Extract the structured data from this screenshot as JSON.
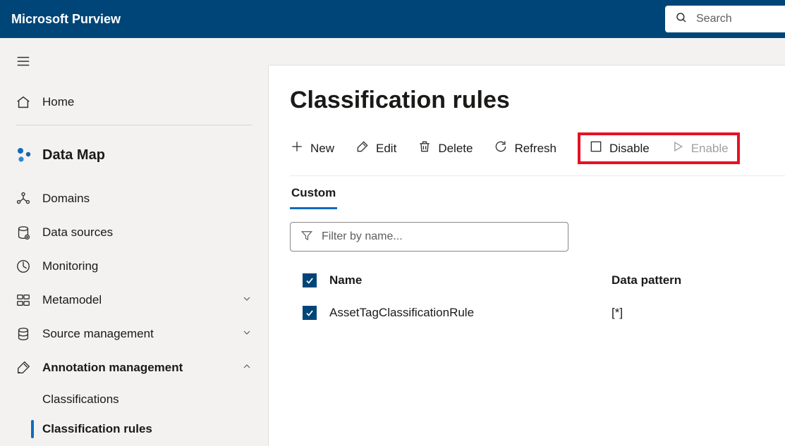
{
  "header": {
    "title": "Microsoft Purview",
    "search_placeholder": "Search"
  },
  "sidebar": {
    "home_label": "Home",
    "section_label": "Data Map",
    "items": {
      "domains": "Domains",
      "data_sources": "Data sources",
      "monitoring": "Monitoring",
      "metamodel": "Metamodel",
      "source_management": "Source management",
      "annotation_management": "Annotation management"
    },
    "sub_items": {
      "classifications": "Classifications",
      "classification_rules": "Classification rules"
    }
  },
  "main": {
    "page_title": "Classification rules",
    "toolbar": {
      "new": "New",
      "edit": "Edit",
      "delete": "Delete",
      "refresh": "Refresh",
      "disable": "Disable",
      "enable": "Enable"
    },
    "tabs": {
      "custom": "Custom"
    },
    "filter_placeholder": "Filter by name...",
    "table": {
      "col_name": "Name",
      "col_pattern": "Data pattern",
      "rows": [
        {
          "name": "AssetTagClassificationRule",
          "pattern": "[*]"
        }
      ]
    }
  }
}
